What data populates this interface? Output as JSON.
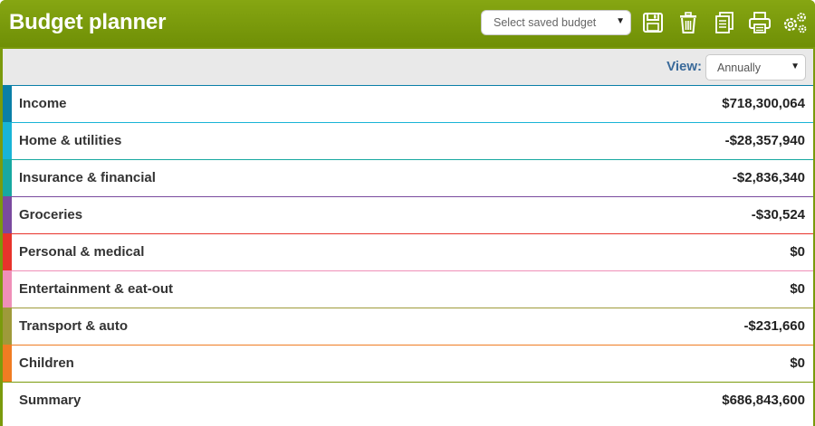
{
  "header": {
    "title": "Budget planner",
    "saved_budget_placeholder": "Select saved budget"
  },
  "toolbar": {
    "icons": [
      "save-icon",
      "trash-icon",
      "document-icon",
      "print-icon",
      "settings-icon"
    ]
  },
  "view": {
    "label": "View:",
    "selected": "Annually"
  },
  "categories": [
    {
      "label": "Income",
      "value": "$718,300,064",
      "color": "#0a7fa7"
    },
    {
      "label": "Home & utilities",
      "value": "-$28,357,940",
      "color": "#19b4d6"
    },
    {
      "label": "Insurance & financial",
      "value": "-$2,836,340",
      "color": "#17a8a0"
    },
    {
      "label": "Groceries",
      "value": "-$30,524",
      "color": "#7a4a9e"
    },
    {
      "label": "Personal & medical",
      "value": "$0",
      "color": "#e8332b"
    },
    {
      "label": "Entertainment & eat-out",
      "value": "$0",
      "color": "#ef8fb8"
    },
    {
      "label": "Transport & auto",
      "value": "-$231,660",
      "color": "#9e9a3a"
    },
    {
      "label": "Children",
      "value": "$0",
      "color": "#f07c22"
    }
  ],
  "summary": {
    "label": "Summary",
    "value": "$686,843,600",
    "color": "#7a9a0c"
  }
}
